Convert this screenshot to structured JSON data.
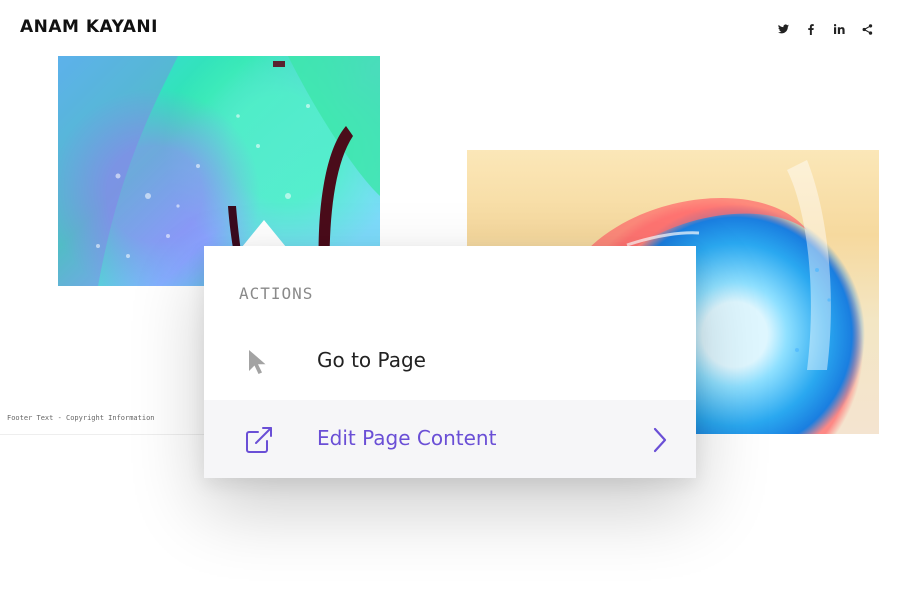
{
  "site": {
    "title": "ANAM KAYANI"
  },
  "social": [
    {
      "name": "twitter-icon"
    },
    {
      "name": "facebook-icon"
    },
    {
      "name": "linkedin-icon",
      "label": "in"
    },
    {
      "name": "share-icon"
    }
  ],
  "footer": {
    "text": "Footer Text - Copyright Information"
  },
  "actions_menu": {
    "title": "ACTIONS",
    "items": [
      {
        "label": "Go to Page",
        "icon": "cursor-arrow-icon"
      },
      {
        "label": "Edit Page Content",
        "icon": "external-link-icon",
        "has_submenu": true
      }
    ]
  },
  "colors": {
    "accent": "#6a4fd6",
    "highlight_row": "#f6f6f8",
    "menu_title": "#8a8a8a"
  }
}
